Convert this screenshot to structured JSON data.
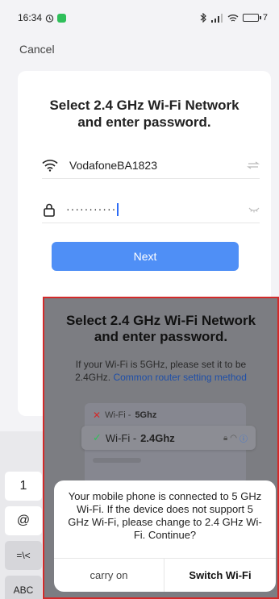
{
  "status_bar": {
    "time": "16:34",
    "battery": "7"
  },
  "header": {
    "cancel_label": "Cancel"
  },
  "card": {
    "title": "Select 2.4 GHz Wi-Fi Network and enter password.",
    "wifi_name": "VodafoneBA1823",
    "password_masked": "···········",
    "next_label": "Next"
  },
  "keyboard": {
    "keys": [
      "1",
      "@",
      "=\\<",
      "ABC"
    ]
  },
  "overlay": {
    "title": "Select 2.4 GHz Wi-Fi Network and enter password.",
    "desc": "If your Wi-Fi is 5GHz, please set it to be 2.4GHz.",
    "link": "Common router setting method",
    "item_bad_prefix": "Wi-Fi - ",
    "item_bad_band": "5Ghz",
    "item_good_prefix": "Wi-Fi - ",
    "item_good_band": "2.4Ghz"
  },
  "dialog": {
    "message": "Your mobile phone is connected to 5 GHz Wi-Fi. If the device does not support 5 GHz Wi-Fi, please change to 2.4 GHz Wi-Fi. Continue?",
    "carry_on_label": "carry on",
    "switch_label": "Switch Wi-Fi"
  },
  "colors": {
    "accent": "#4f8ff6",
    "highlight_border": "#d32a2a",
    "check": "#2fbf5a",
    "cross": "#d32a2a"
  }
}
